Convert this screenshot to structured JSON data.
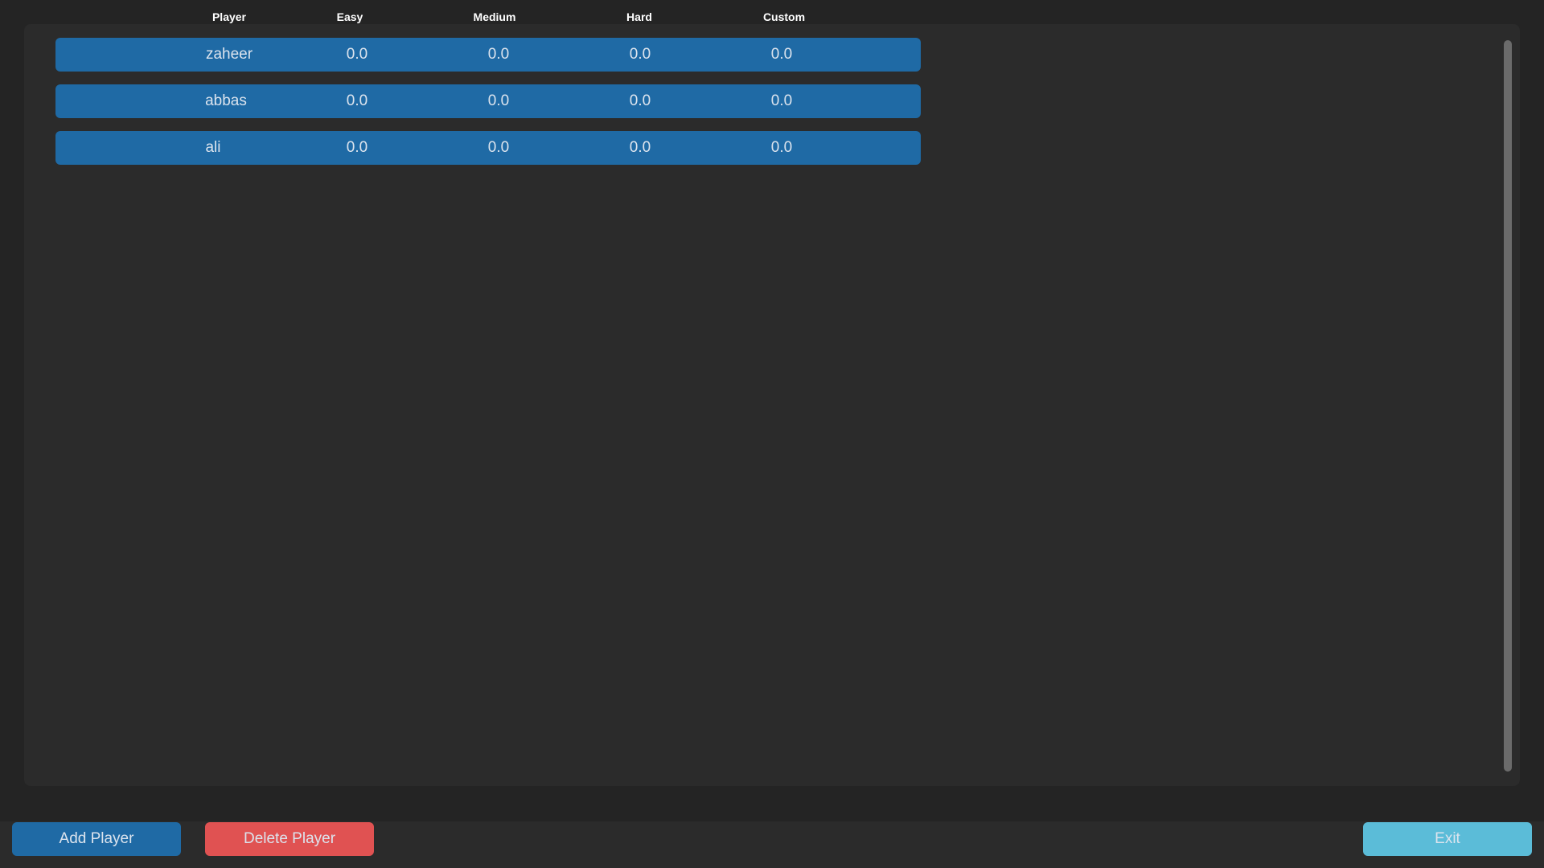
{
  "table": {
    "headers": [
      "Player",
      "Easy",
      "Medium",
      "Hard",
      "Custom"
    ],
    "rows": [
      {
        "player": "zaheer",
        "easy": "0.0",
        "medium": "0.0",
        "hard": "0.0",
        "custom": "0.0"
      },
      {
        "player": "abbas",
        "easy": "0.0",
        "medium": "0.0",
        "hard": "0.0",
        "custom": "0.0"
      },
      {
        "player": "ali",
        "easy": "0.0",
        "medium": "0.0",
        "hard": "0.0",
        "custom": "0.0"
      }
    ]
  },
  "buttons": {
    "add": "Add Player",
    "delete": "Delete Player",
    "exit": "Exit"
  },
  "colors": {
    "background": "#242424",
    "panel": "#2b2b2b",
    "row": "#1f6aa5",
    "add_button": "#1f6aa5",
    "delete_button": "#e05252",
    "exit_button": "#5bbcd8",
    "scrollbar": "#6b6b6b"
  }
}
